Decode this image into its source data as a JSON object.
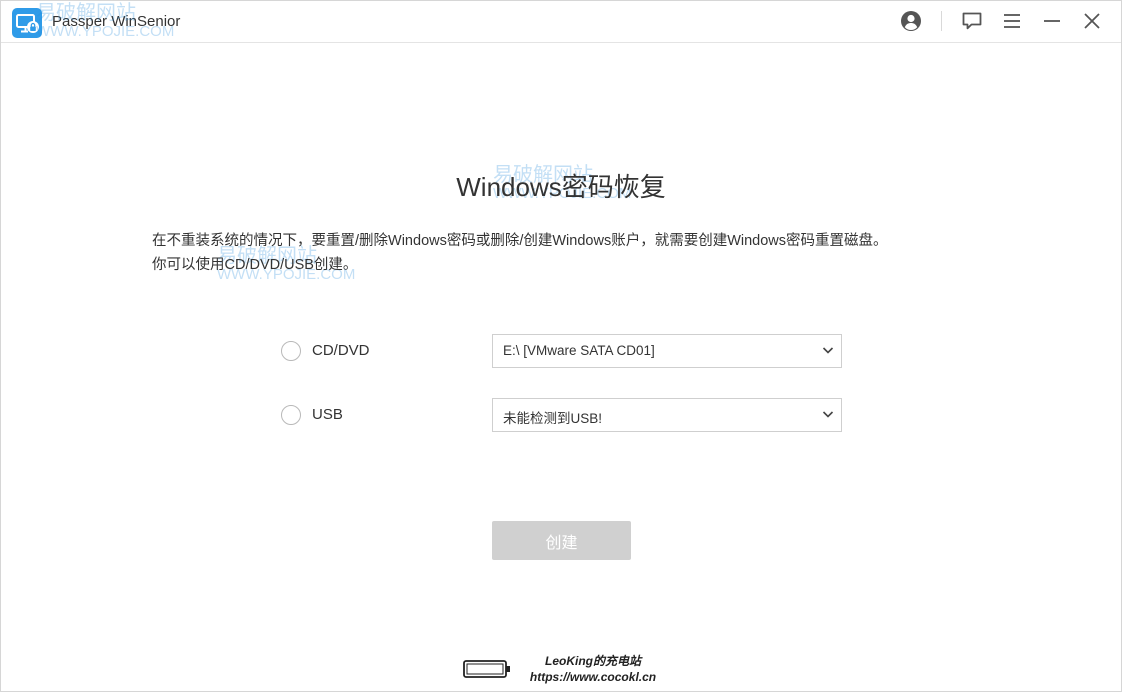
{
  "app": {
    "title": "Passper WinSenior",
    "logo_icon": "monitor-lock-icon",
    "accent_color": "#2f9be8"
  },
  "titlebar": {
    "icons": [
      "account-icon",
      "feedback-icon",
      "menu-icon",
      "minimize-icon",
      "close-icon"
    ]
  },
  "watermarks": [
    {
      "cn": "易破解网站",
      "en": "WWW.YPOJIE.COM"
    },
    {
      "cn": "易破解网站",
      "en": "WWW.YPOJIE.COM"
    },
    {
      "cn": "易破解网站",
      "en": "WWW.YPOJIE.COM"
    }
  ],
  "main": {
    "heading": "Windows密码恢复",
    "description_line1": "在不重装系统的情况下，要重置/删除Windows密码或删除/创建Windows账户，就需要创建Windows密码重置磁盘。",
    "description_line2": "你可以使用CD/DVD/USB创建。",
    "options": [
      {
        "label": "CD/DVD",
        "selected_value": "E:\\ [VMware SATA CD01]",
        "checked": false
      },
      {
        "label": "USB",
        "selected_value": "未能检测到USB!",
        "checked": false
      }
    ],
    "create_button": "创建",
    "create_button_color": "#d0d0d0"
  },
  "footer": {
    "line1": "LeoKing的充电站",
    "line2": "https://www.cocokl.cn"
  }
}
